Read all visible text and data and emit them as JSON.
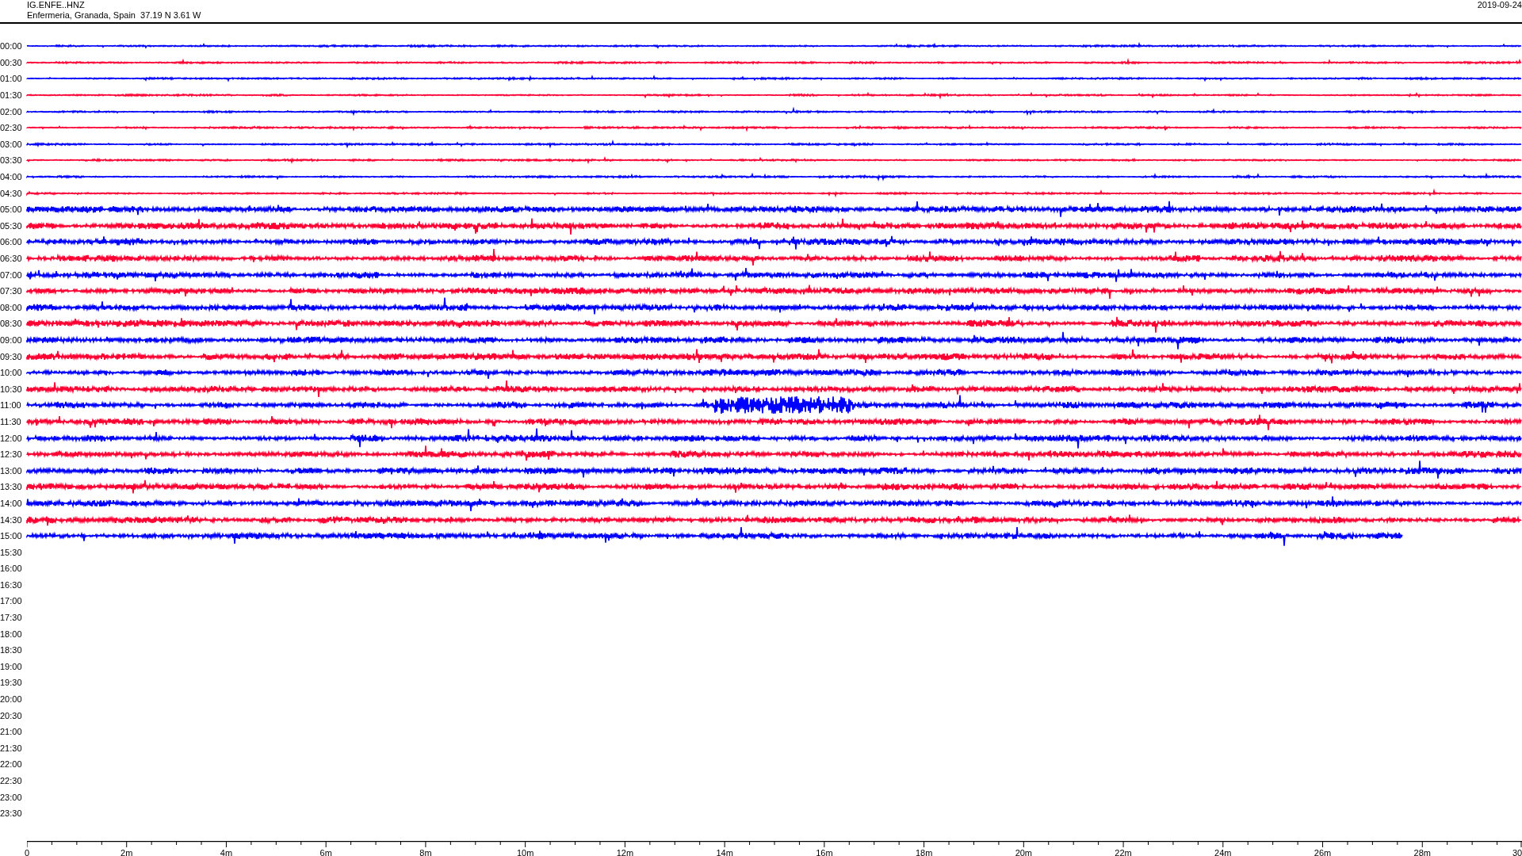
{
  "header": {
    "station": "IG.ENFE..HNZ",
    "location": "Enfermeria, Granada, Spain  37.19 N 3.61 W",
    "date": "2019-09-24"
  },
  "rows": [
    {
      "time": "00:00",
      "kind": "full",
      "color": "#0000ff"
    },
    {
      "time": "00:30",
      "kind": "full",
      "color": "#ff0033"
    },
    {
      "time": "01:00",
      "kind": "full",
      "color": "#0000ff"
    },
    {
      "time": "01:30",
      "kind": "full",
      "color": "#ff0033"
    },
    {
      "time": "02:00",
      "kind": "full",
      "color": "#0000ff"
    },
    {
      "time": "02:30",
      "kind": "full",
      "color": "#ff0033"
    },
    {
      "time": "03:00",
      "kind": "full",
      "color": "#0000ff"
    },
    {
      "time": "03:30",
      "kind": "full",
      "color": "#ff0033"
    },
    {
      "time": "04:00",
      "kind": "full",
      "color": "#0000ff"
    },
    {
      "time": "04:30",
      "kind": "full",
      "color": "#ff0033"
    },
    {
      "time": "05:00",
      "kind": "full",
      "color": "#0000ff"
    },
    {
      "time": "05:30",
      "kind": "full",
      "color": "#ff0033"
    },
    {
      "time": "06:00",
      "kind": "full",
      "color": "#0000ff"
    },
    {
      "time": "06:30",
      "kind": "full",
      "color": "#ff0033"
    },
    {
      "time": "07:00",
      "kind": "full",
      "color": "#0000ff"
    },
    {
      "time": "07:30",
      "kind": "full",
      "color": "#ff0033"
    },
    {
      "time": "08:00",
      "kind": "full",
      "color": "#0000ff"
    },
    {
      "time": "08:30",
      "kind": "full",
      "color": "#ff0033"
    },
    {
      "time": "09:00",
      "kind": "full",
      "color": "#0000ff"
    },
    {
      "time": "09:30",
      "kind": "full",
      "color": "#ff0033"
    },
    {
      "time": "10:00",
      "kind": "full",
      "color": "#0000ff"
    },
    {
      "time": "10:30",
      "kind": "full",
      "color": "#ff0033"
    },
    {
      "time": "11:00",
      "kind": "event",
      "color": "#0000ff"
    },
    {
      "time": "11:30",
      "kind": "full",
      "color": "#ff0033"
    },
    {
      "time": "12:00",
      "kind": "full",
      "color": "#0000ff"
    },
    {
      "time": "12:30",
      "kind": "full",
      "color": "#ff0033"
    },
    {
      "time": "13:00",
      "kind": "full",
      "color": "#0000ff"
    },
    {
      "time": "13:30",
      "kind": "full",
      "color": "#ff0033"
    },
    {
      "time": "14:00",
      "kind": "full",
      "color": "#0000ff"
    },
    {
      "time": "14:30",
      "kind": "full",
      "color": "#ff0033"
    },
    {
      "time": "15:00",
      "kind": "partial",
      "color": "#0000ff"
    },
    {
      "time": "15:30",
      "kind": "empty"
    },
    {
      "time": "16:00",
      "kind": "empty"
    },
    {
      "time": "16:30",
      "kind": "empty"
    },
    {
      "time": "17:00",
      "kind": "empty"
    },
    {
      "time": "17:30",
      "kind": "empty"
    },
    {
      "time": "18:00",
      "kind": "empty"
    },
    {
      "time": "18:30",
      "kind": "empty"
    },
    {
      "time": "19:00",
      "kind": "empty"
    },
    {
      "time": "19:30",
      "kind": "empty"
    },
    {
      "time": "20:00",
      "kind": "empty"
    },
    {
      "time": "20:30",
      "kind": "empty"
    },
    {
      "time": "21:00",
      "kind": "empty"
    },
    {
      "time": "21:30",
      "kind": "empty"
    },
    {
      "time": "22:00",
      "kind": "empty"
    },
    {
      "time": "22:30",
      "kind": "empty"
    },
    {
      "time": "23:00",
      "kind": "empty"
    },
    {
      "time": "23:30",
      "kind": "empty"
    }
  ],
  "x_axis": {
    "labels": [
      "0",
      "2m",
      "4m",
      "6m",
      "8m",
      "10m",
      "12m",
      "14m",
      "16m",
      "18m",
      "20m",
      "22m",
      "24m",
      "26m",
      "28m",
      "30"
    ]
  }
}
